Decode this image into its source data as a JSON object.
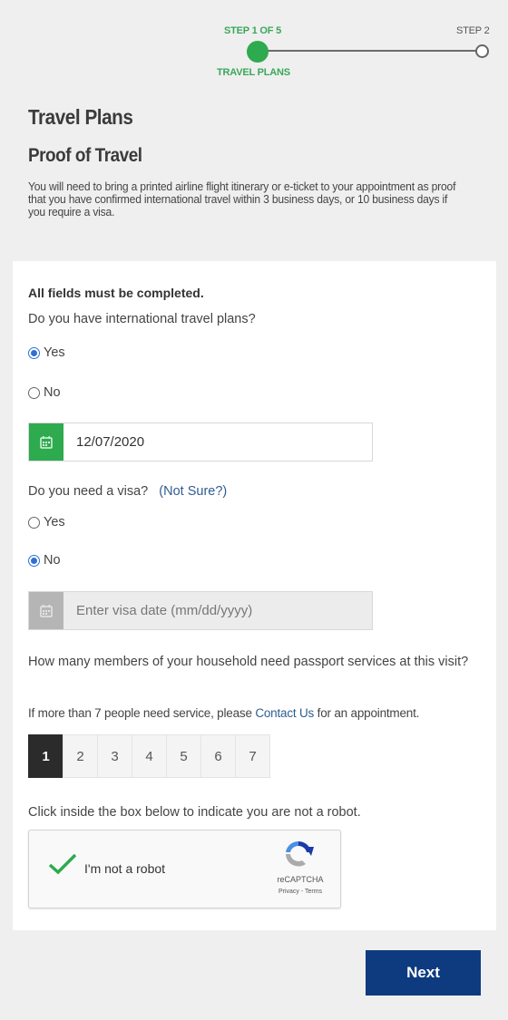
{
  "stepper": {
    "current_step_label": "STEP 1 OF 5",
    "current_step_name": "TRAVEL PLANS",
    "next_step_label": "STEP 2",
    "current_step": 1,
    "total_steps": 5,
    "active_color": "#2eaa4f"
  },
  "header": {
    "title": "Travel Plans",
    "section_title": "Proof of Travel",
    "intro": "You will need to bring a printed airline flight itinerary or e-ticket to your appointment as proof that you have confirmed international travel within 3 business days, or 10 business days if you require a visa."
  },
  "form": {
    "required_notice": "All fields must be completed.",
    "travel_question": "Do you have international travel plans?",
    "travel_options": [
      {
        "label": "Yes",
        "selected": true
      },
      {
        "label": "No",
        "selected": false
      }
    ],
    "travel_date": {
      "value": "12/07/2020",
      "icon": "calendar-icon"
    },
    "visa_question": "Do you need a visa?",
    "visa_help_link": "(Not Sure?)",
    "visa_options": [
      {
        "label": "Yes",
        "selected": false
      },
      {
        "label": "No",
        "selected": true
      }
    ],
    "visa_date": {
      "value": "",
      "placeholder": "Enter visa date (mm/dd/yyyy)",
      "icon": "calendar-icon",
      "disabled": true
    },
    "household_question": "How many members of your household need passport services at this visit?",
    "household_note_before": "If more than 7 people need service, please ",
    "household_note_link": "Contact Us",
    "household_note_after": " for an appointment.",
    "household_options": [
      "1",
      "2",
      "3",
      "4",
      "5",
      "6",
      "7"
    ],
    "household_selected": "1",
    "captcha_instruction": "Click inside the box below to indicate you are not a robot.",
    "captcha": {
      "label": "I'm not a robot",
      "checked": true,
      "brand": "reCAPTCHA",
      "terms": "Privacy - Terms"
    }
  },
  "actions": {
    "next_label": "Next",
    "next_color": "#0e3b7f"
  }
}
